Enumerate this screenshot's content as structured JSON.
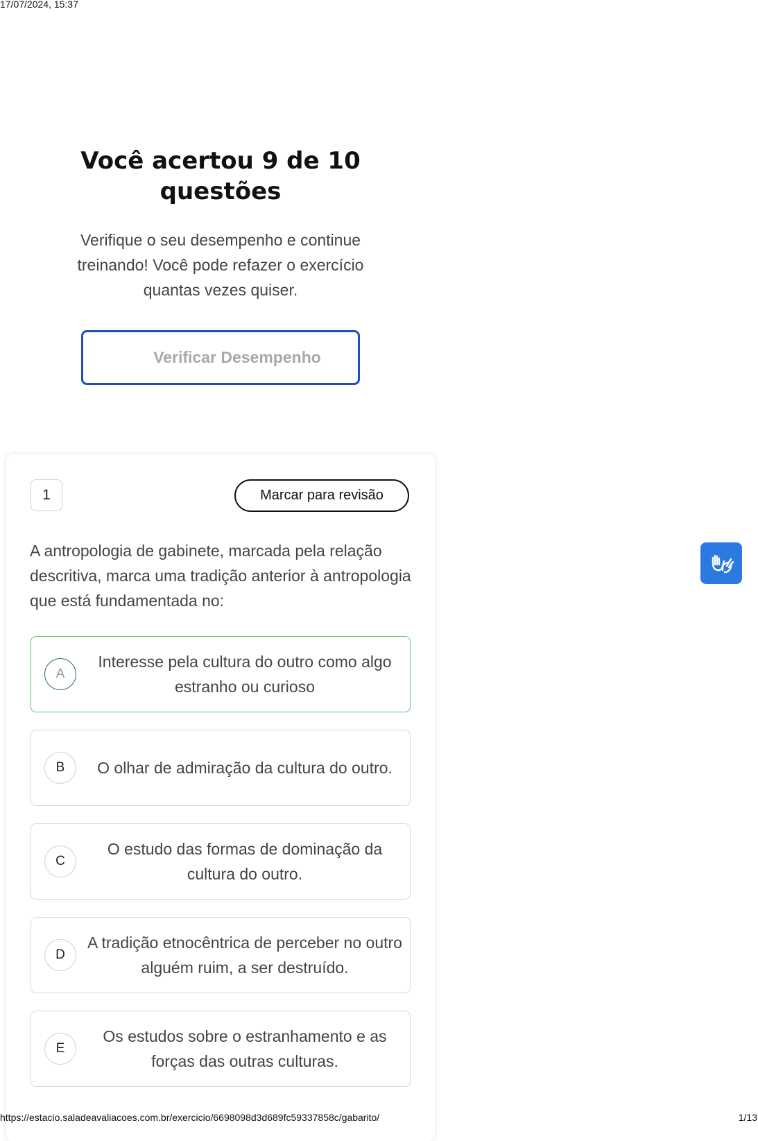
{
  "print_header": {
    "timestamp": "17/07/2024, 15:37"
  },
  "print_footer": {
    "url": "https://estacio.saladeavaliacoes.com.br/exercicio/6698098d3d689fc59337858c/gabarito/",
    "page": "1/13"
  },
  "summary": {
    "title": "Você acertou 9 de 10 questões",
    "subtitle": "Verifique o seu desempenho e continue treinando! Você pode refazer o exercício quantas vezes quiser.",
    "verify_button": "Verificar Desempenho"
  },
  "question": {
    "number": "1",
    "mark_review_button": "Marcar para revisão",
    "text": "A antropologia de gabinete, marcada pela relação descritiva, marca uma tradição anterior à antropologia que está fundamentada no:",
    "options": [
      {
        "letter": "A",
        "text": "Interesse pela cultura do outro como algo estranho ou curioso",
        "state": "correct"
      },
      {
        "letter": "B",
        "text": "O olhar de admiração da cultura do outro.",
        "state": "default"
      },
      {
        "letter": "C",
        "text": "O estudo das formas de dominação da cultura do outro.",
        "state": "default"
      },
      {
        "letter": "D",
        "text": "A tradição etnocêntrica de perceber no outro alguém ruim, a ser destruído.",
        "state": "default"
      },
      {
        "letter": "E",
        "text": "Os estudos sobre o estranhamento e as forças das outras culturas.",
        "state": "default"
      }
    ]
  },
  "accessibility": {
    "icon": "sign-language-icon",
    "color": "#2a7ae2"
  },
  "colors": {
    "accent": "#1f4fbf",
    "correct": "#5ec46e"
  }
}
